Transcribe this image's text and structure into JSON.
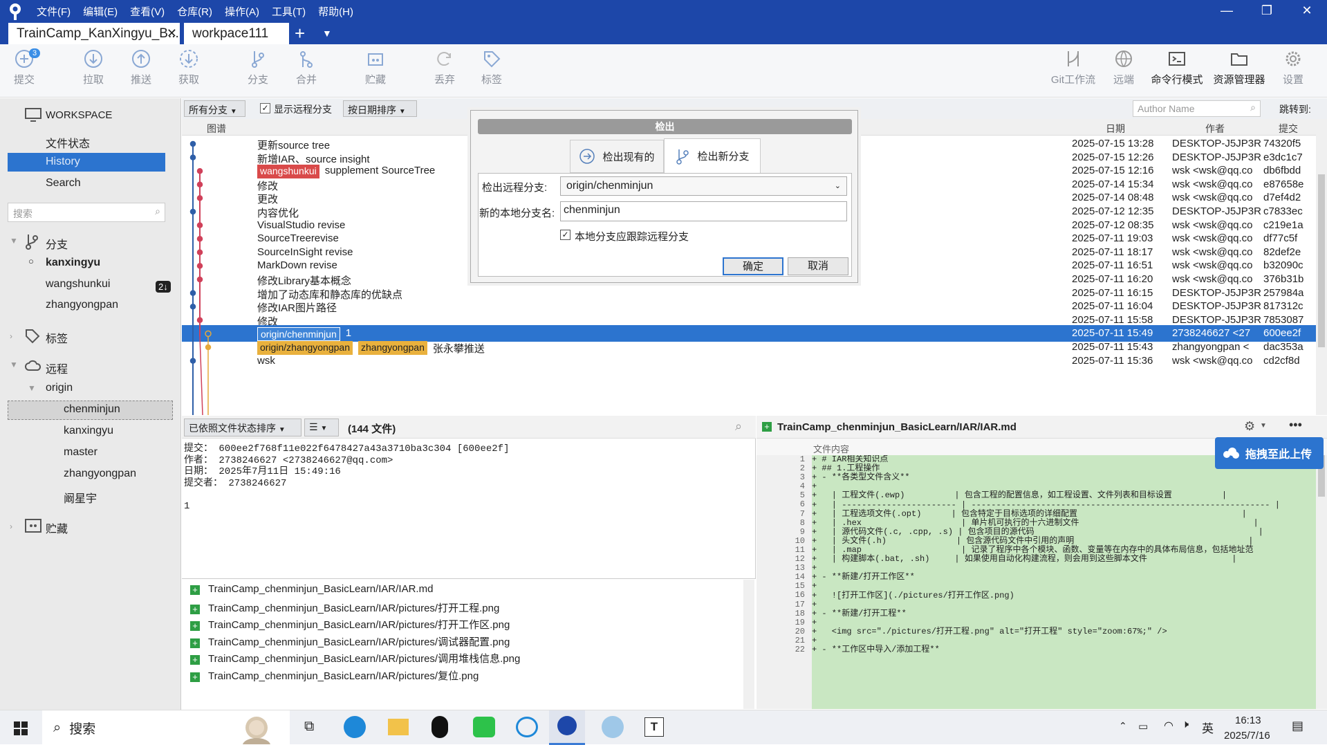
{
  "menu": [
    "文件(F)",
    "编辑(E)",
    "查看(V)",
    "仓库(R)",
    "操作(A)",
    "工具(T)",
    "帮助(H)"
  ],
  "tabs": [
    "TrainCamp_KanXingyu_B...",
    "workpace111"
  ],
  "toolbar": {
    "commit": "提交",
    "commit_badge": "3",
    "pull": "拉取",
    "push": "推送",
    "fetch": "获取",
    "branch": "分支",
    "merge": "合并",
    "stash": "贮藏",
    "discard": "丢弃",
    "tag": "标签",
    "gitflow": "Git工作流",
    "remote": "远端",
    "terminal": "命令行模式",
    "explorer": "资源管理器",
    "settings": "设置"
  },
  "sidebar": {
    "workspace": "WORKSPACE",
    "file_status": "文件状态",
    "history": "History",
    "search": "Search",
    "search_placeholder": "搜索",
    "branches": "分支",
    "branch_items": [
      "kanxingyu",
      "wangshunkui",
      "zhangyongpan"
    ],
    "wangshunkui_badge": "2↓",
    "tags": "标签",
    "remotes": "远程",
    "origin": "origin",
    "remote_items": [
      "chenminjun",
      "kanxingyu",
      "master",
      "zhangyongpan",
      "阚星宇"
    ],
    "stash": "贮藏"
  },
  "filter": {
    "all_branches": "所有分支",
    "show_remote": "显示远程分支",
    "sort_date": "按日期排序",
    "author_placeholder": "Author Name",
    "jump": "跳转到:"
  },
  "columns": {
    "graph": "图谱",
    "date": "日期",
    "author": "作者",
    "commit": "提交"
  },
  "commits": [
    {
      "msg": "更新source tree",
      "date": "2025-07-15 13:28",
      "author": "DESKTOP-J5JP3R",
      "hash": "74320f5"
    },
    {
      "msg": "新增IAR、source insight",
      "date": "2025-07-15 12:26",
      "author": "DESKTOP-J5JP3R",
      "hash": "e3dc1c7"
    },
    {
      "tag": "wangshunkui",
      "msg": "supplement SourceTree",
      "date": "2025-07-15 12:16",
      "author": "wsk <wsk@qq.co",
      "hash": "db6fbdd"
    },
    {
      "msg": "修改",
      "date": "2025-07-14 15:34",
      "author": "wsk <wsk@qq.co",
      "hash": "e87658e"
    },
    {
      "msg": "更改",
      "date": "2025-07-14 08:48",
      "author": "wsk <wsk@qq.co",
      "hash": "d7ef4d2"
    },
    {
      "msg": "内容优化",
      "date": "2025-07-12 12:35",
      "author": "DESKTOP-J5JP3R",
      "hash": "c7833ec"
    },
    {
      "msg": "VisualStudio revise",
      "date": "2025-07-12 08:35",
      "author": "wsk <wsk@qq.co",
      "hash": "c219e1a"
    },
    {
      "msg": "SourceTreerevise",
      "date": "2025-07-11 19:03",
      "author": "wsk <wsk@qq.co",
      "hash": "df77c5f"
    },
    {
      "msg": "SourceInSight revise",
      "date": "2025-07-11 18:17",
      "author": "wsk <wsk@qq.co",
      "hash": "82def2e"
    },
    {
      "msg": "MarkDown revise",
      "date": "2025-07-11 16:51",
      "author": "wsk <wsk@qq.co",
      "hash": "b32090c"
    },
    {
      "msg": "修改Library基本概念",
      "date": "2025-07-11 16:20",
      "author": "wsk <wsk@qq.co",
      "hash": "376b31b"
    },
    {
      "msg": "增加了动态库和静态库的优缺点",
      "date": "2025-07-11 16:15",
      "author": "DESKTOP-J5JP3R",
      "hash": "257984a"
    },
    {
      "msg": "修改IAR图片路径",
      "date": "2025-07-11 16:04",
      "author": "DESKTOP-J5JP3R",
      "hash": "817312c"
    },
    {
      "msg": "修改",
      "date": "2025-07-11 15:58",
      "author": "DESKTOP-J5JP3R",
      "hash": "7853087"
    },
    {
      "tag": "origin/chenminjun",
      "msg": "1",
      "date": "2025-07-11 15:49",
      "author": "2738246627 <27",
      "hash": "600ee2f"
    },
    {
      "tag": "origin/zhangyongpan",
      "tag2": "zhangyongpan",
      "msg": "张永攀推送",
      "date": "2025-07-11 15:43",
      "author": "zhangyongpan <",
      "hash": "dac353a"
    },
    {
      "msg": "wsk",
      "date": "2025-07-11 15:36",
      "author": "wsk <wsk@qq.co",
      "hash": "cd2cf8d"
    }
  ],
  "bottom_left": {
    "sort": "已依照文件状态排序",
    "file_count": "(144 文件)",
    "details": "提交： 600ee2f768f11e022f6478427a43a3710ba3c304 [600ee2f]\n作者： 2738246627 <2738246627@qq.com>\n日期： 2025年7月11日 15:49:16\n提交者： 2738246627\n\n1",
    "files": [
      "TrainCamp_chenminjun_BasicLearn/IAR/IAR.md",
      "TrainCamp_chenminjun_BasicLearn/IAR/pictures/打开工程.png",
      "TrainCamp_chenminjun_BasicLearn/IAR/pictures/打开工作区.png",
      "TrainCamp_chenminjun_BasicLearn/IAR/pictures/调试器配置.png",
      "TrainCamp_chenminjun_BasicLearn/IAR/pictures/调用堆栈信息.png",
      "TrainCamp_chenminjun_BasicLearn/IAR/pictures/复位.png"
    ]
  },
  "bottom_right": {
    "path": "TrainCamp_chenminjun_BasicLearn/IAR/IAR.md",
    "content_label": "文件内容",
    "upload": "拖拽至此上传",
    "lines": [
      "+ # IAR相关知识点",
      "+ ## 1.工程操作",
      "+ - **各类型文件含义**",
      "+ ",
      "+   | 工程文件(.ewp)          | 包含工程的配置信息，如工程设置、文件列表和目标设置          |",
      "+   | ----------------------- | ------------------------------------------------------------ |",
      "+   | 工程选项文件(.opt)      | 包含特定于目标选项的详细配置                                 |",
      "+   | .hex                    | 单片机可执行的十六进制文件                                   |",
      "+   | 源代码文件(.c, .cpp, .s) | 包含项目的源代码                                             |",
      "+   | 头文件(.h)              | 包含源代码文件中引用的声明                                   |",
      "+   | .map                    | 记录了程序中各个模块、函数、变量等在内存中的具体布局信息，包括地址范",
      "+   | 构建脚本(.bat, .sh)     | 如果使用自动化构建流程，则会用到这些脚本文件                 |",
      "+ ",
      "+ - **新建/打开工作区**",
      "+ ",
      "+   ![打开工作区](./pictures/打开工作区.png)",
      "+ ",
      "+ - **新建/打开工程**",
      "+ ",
      "+   <img src=\"./pictures/打开工程.png\" alt=\"打开工程\" style=\"zoom:67%;\" />",
      "+ ",
      "+ - **工作区中导入/添加工程**"
    ]
  },
  "dialog": {
    "title": "检出",
    "tab_existing": "检出现有的",
    "tab_new": "检出新分支",
    "remote_label": "检出远程分支:",
    "remote_value": "origin/chenminjun",
    "local_label": "新的本地分支名:",
    "local_value": "chenminjun",
    "track": "本地分支应跟踪远程分支",
    "ok": "确定",
    "cancel": "取消"
  },
  "taskbar": {
    "search": "搜索",
    "ime": "英",
    "time": "16:13",
    "date": "2025/7/16"
  }
}
